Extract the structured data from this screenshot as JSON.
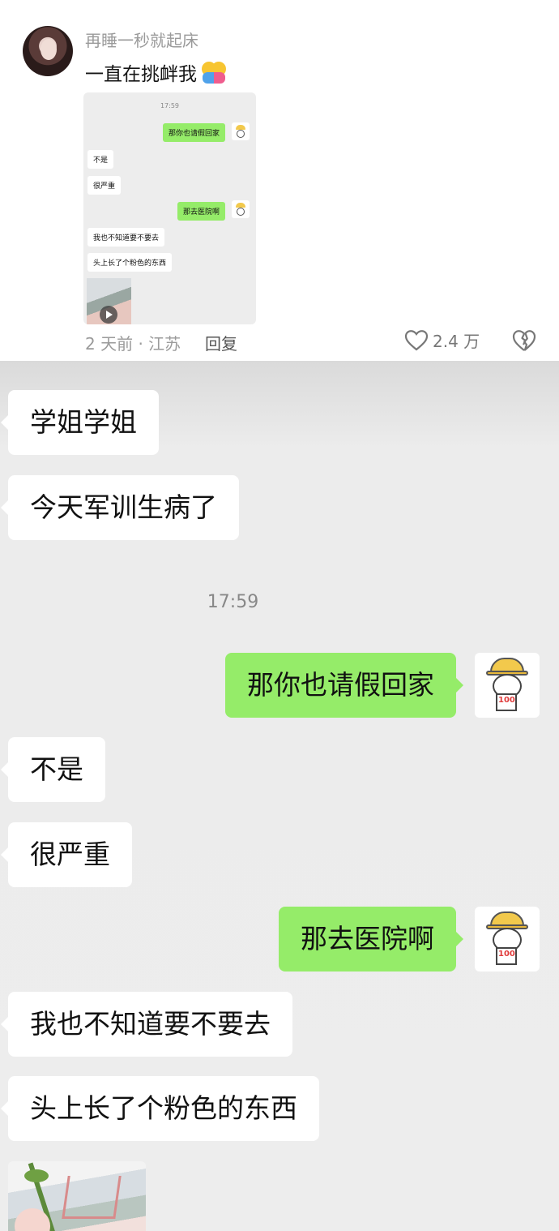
{
  "comment": {
    "username": "再睡一秒就起床",
    "text": "一直在挑衅我",
    "emoji": "people-hugging-emoji",
    "meta": "2 天前 · 江苏",
    "reply_label": "回复",
    "like_count": "2.4 万",
    "thumbnail": {
      "time": "17:59",
      "messages": [
        {
          "side": "out",
          "text": "那你也请假回家"
        },
        {
          "side": "in",
          "text": "不是"
        },
        {
          "side": "in",
          "text": "很严重"
        },
        {
          "side": "out",
          "text": "那去医院啊"
        },
        {
          "side": "in",
          "text": "我也不知道要不要去"
        },
        {
          "side": "in",
          "text": "头上长了个粉色的东西"
        }
      ]
    }
  },
  "chat": {
    "time": "17:59",
    "messages": [
      {
        "side": "in",
        "text": "学姐学姐"
      },
      {
        "side": "in",
        "text": "今天军训生病了"
      },
      {
        "side": "out",
        "text": "那你也请假回家"
      },
      {
        "side": "in",
        "text": "不是"
      },
      {
        "side": "in",
        "text": "很严重"
      },
      {
        "side": "out",
        "text": "那去医院啊"
      },
      {
        "side": "in",
        "text": "我也不知道要不要去"
      },
      {
        "side": "in",
        "text": "头上长了个粉色的东西"
      }
    ],
    "avatar_badge": "100"
  },
  "colors": {
    "out_bubble": "#95ec69",
    "in_bubble": "#ffffff",
    "chat_bg": "#ededed",
    "muted_text": "#9a9a9a"
  }
}
